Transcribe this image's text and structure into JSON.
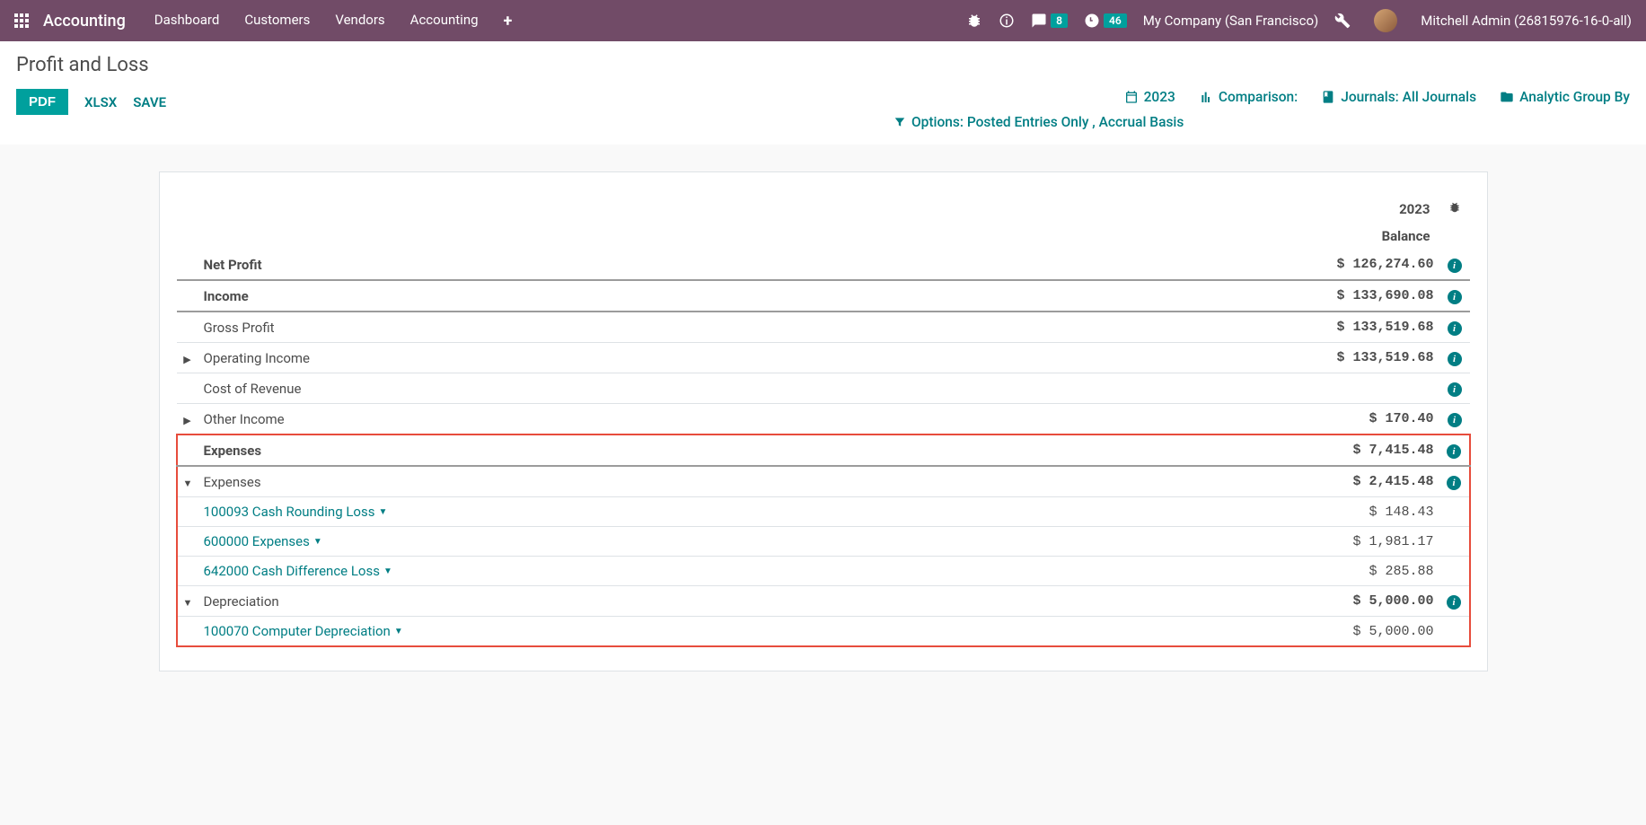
{
  "nav": {
    "app_title": "Accounting",
    "menu": [
      "Dashboard",
      "Customers",
      "Vendors",
      "Accounting"
    ],
    "messages_count": "8",
    "activities_count": "46",
    "company": "My Company (San Francisco)",
    "user": "Mitchell Admin (26815976-16-0-all)"
  },
  "cp": {
    "title": "Profit and Loss",
    "buttons": {
      "pdf": "PDF",
      "xlsx": "XLSX",
      "save": "SAVE"
    },
    "filters": {
      "date": "2023",
      "comparison": "Comparison:",
      "journals": "Journals: All Journals",
      "analytic": "Analytic Group By",
      "options": "Options: Posted Entries Only , Accrual Basis"
    }
  },
  "report": {
    "col_year": "2023",
    "col_balance": "Balance",
    "rows": [
      {
        "label": "Net Profit",
        "value": "$ 126,274.60"
      },
      {
        "label": "Income",
        "value": "$ 133,690.08"
      },
      {
        "label": "Gross Profit",
        "value": "$ 133,519.68"
      },
      {
        "label": "Operating Income",
        "value": "$ 133,519.68"
      },
      {
        "label": "Cost of Revenue",
        "value": ""
      },
      {
        "label": "Other Income",
        "value": "$ 170.40"
      },
      {
        "label": "Expenses",
        "value": "$ 7,415.48"
      },
      {
        "label": "Expenses",
        "value": "$ 2,415.48"
      },
      {
        "label": "100093 Cash Rounding Loss",
        "value": "$ 148.43"
      },
      {
        "label": "600000 Expenses",
        "value": "$ 1,981.17"
      },
      {
        "label": "642000 Cash Difference Loss",
        "value": "$ 285.88"
      },
      {
        "label": "Depreciation",
        "value": "$ 5,000.00"
      },
      {
        "label": "100070 Computer Depreciation",
        "value": "$ 5,000.00"
      }
    ]
  }
}
